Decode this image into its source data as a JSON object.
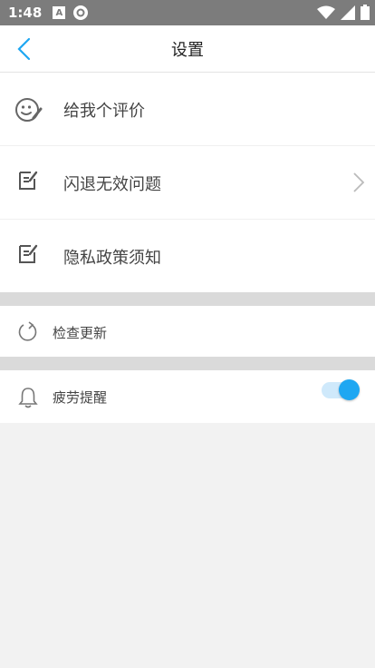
{
  "status_bar": {
    "time": "1:48",
    "badge_letter": "A"
  },
  "header": {
    "title": "设置"
  },
  "section_main": [
    {
      "label": "给我个评价"
    },
    {
      "label": "闪退无效问题"
    },
    {
      "label": "隐私政策须知"
    }
  ],
  "check_update": {
    "label": "检查更新"
  },
  "fatigue_reminder": {
    "label": "疲劳提醒",
    "enabled": true
  },
  "colors": {
    "accent": "#1ea7f2",
    "back_arrow": "#1ea7f2"
  }
}
